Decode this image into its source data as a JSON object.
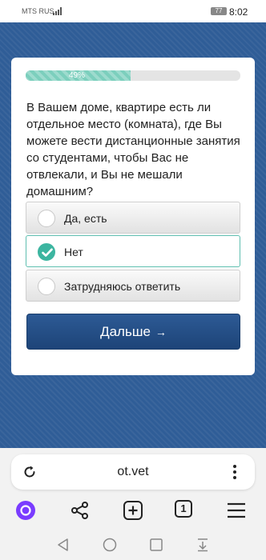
{
  "status": {
    "carrier": "MTS RUS",
    "battery": "77",
    "time": "8:02"
  },
  "survey": {
    "progress_percent": 49,
    "progress_label": "49%",
    "question": "В Вашем доме, квартире есть ли отдельное место (комната), где Вы можете вести дистанционные занятия со студентами, чтобы Вас не отвлекали, и Вы не мешали домашним?",
    "options": [
      {
        "label": "Да, есть",
        "selected": false
      },
      {
        "label": "Нет",
        "selected": true
      },
      {
        "label": "Затрудняюсь ответить",
        "selected": false
      }
    ],
    "next_label": "Дальше",
    "next_arrow": "→"
  },
  "browser": {
    "url": "ot.vet",
    "tabs_count": "1"
  },
  "colors": {
    "background": "#2f5d97",
    "progress_fill": "#7ccfbd",
    "accent_teal": "#3cb5a0",
    "button": "#1d4478",
    "alice_purple": "#7a3cff"
  }
}
